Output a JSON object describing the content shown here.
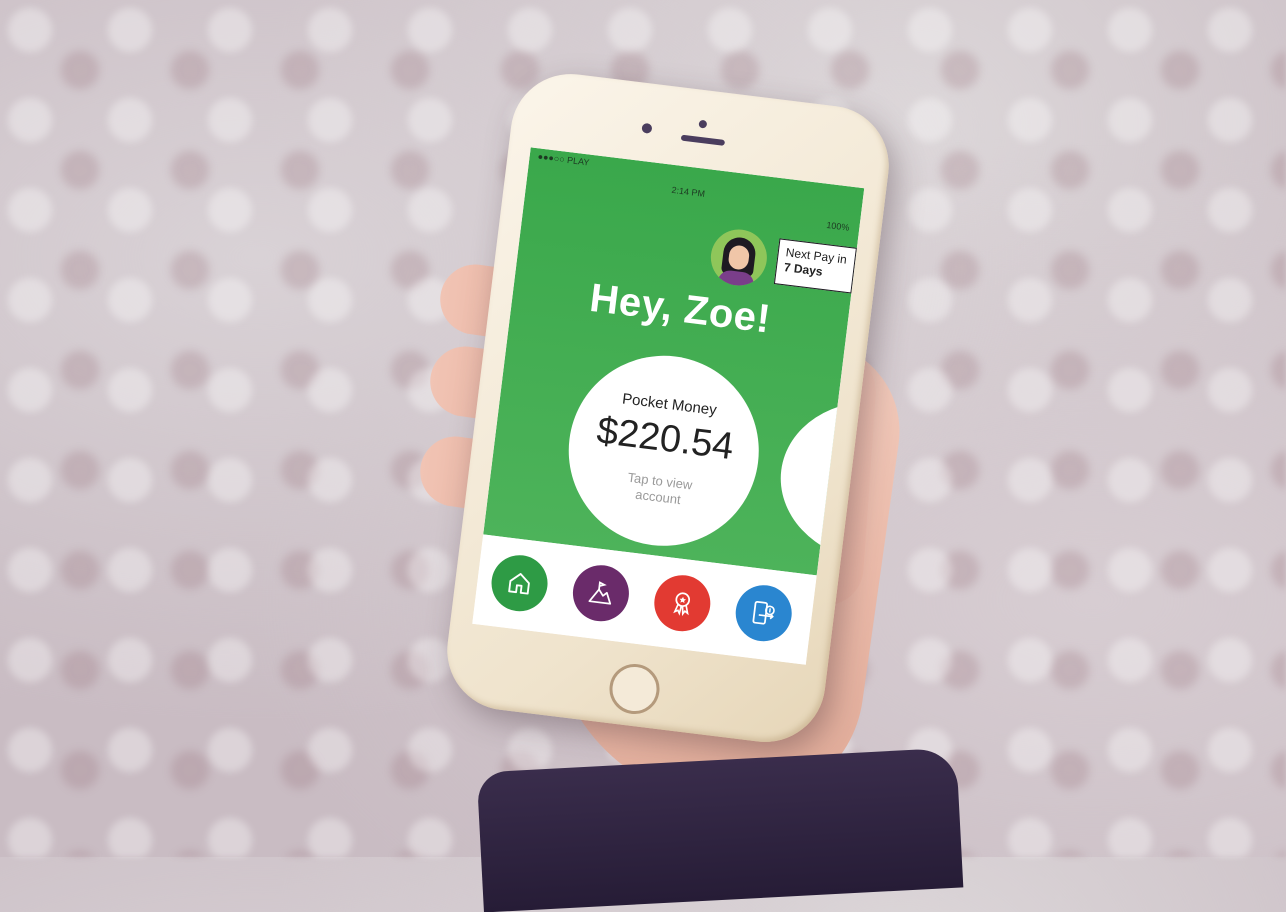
{
  "status_bar": {
    "carrier": "●●●○○ PLAY",
    "time": "2:14 PM",
    "battery": "100%"
  },
  "header": {
    "next_pay_label": "Next Pay in",
    "next_pay_value": "7 Days",
    "greeting": "Hey, Zoe!"
  },
  "account_card": {
    "title": "Pocket Money",
    "amount": "$220.54",
    "hint": "Tap to view account"
  },
  "pager": {
    "pages": 2,
    "active_index": 0
  },
  "nav": {
    "items": [
      {
        "name": "home",
        "icon": "house-icon",
        "color": "#2e9b45"
      },
      {
        "name": "goals",
        "icon": "mountain-flag-icon",
        "color": "#6a2b6a"
      },
      {
        "name": "rewards",
        "icon": "award-ribbon-icon",
        "color": "#e23a32"
      },
      {
        "name": "transfer",
        "icon": "phone-money-icon",
        "color": "#2a86d0"
      }
    ]
  },
  "colors": {
    "primary_green": "#3aa84b",
    "goals_purple": "#6a2b6a",
    "rewards_red": "#e23a32",
    "transfer_blue": "#2a86d0"
  }
}
